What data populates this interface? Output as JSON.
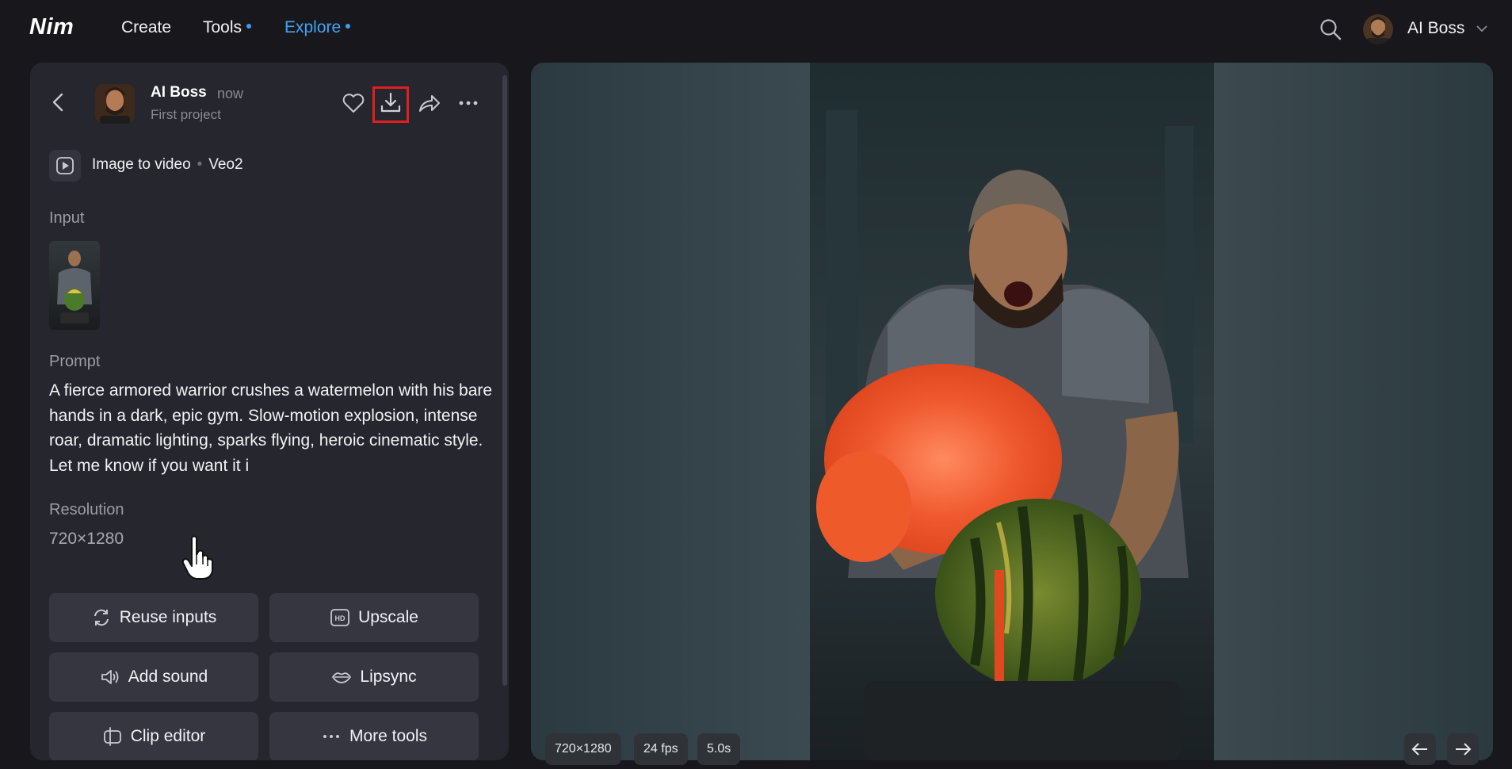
{
  "app": {
    "logo": "Nim",
    "nav": [
      {
        "label": "Create"
      },
      {
        "label": "Tools"
      },
      {
        "label": "Explore"
      }
    ],
    "user_name": "AI Boss"
  },
  "post": {
    "author": "AI Boss",
    "time": "now",
    "project": "First project",
    "mode": "Image to video",
    "model": "Veo2",
    "input_label": "Input",
    "prompt_label": "Prompt",
    "prompt": "A fierce armored warrior crushes a watermelon with his bare hands in a dark, epic gym. Slow-motion explosion, intense roar, dramatic lighting, sparks flying, heroic cinematic style. Let me know if you want it i",
    "resolution_label": "Resolution",
    "resolution": "720×1280"
  },
  "actions": {
    "reuse": "Reuse inputs",
    "upscale": "Upscale",
    "add_sound": "Add sound",
    "lipsync": "Lipsync",
    "clip_editor": "Clip editor",
    "more_tools": "More tools"
  },
  "video_meta": {
    "resolution": "720×1280",
    "fps": "24 fps",
    "duration": "5.0s"
  },
  "colors": {
    "accent": "#42a3f5",
    "highlight": "#e02020",
    "panel": "#26262e"
  }
}
